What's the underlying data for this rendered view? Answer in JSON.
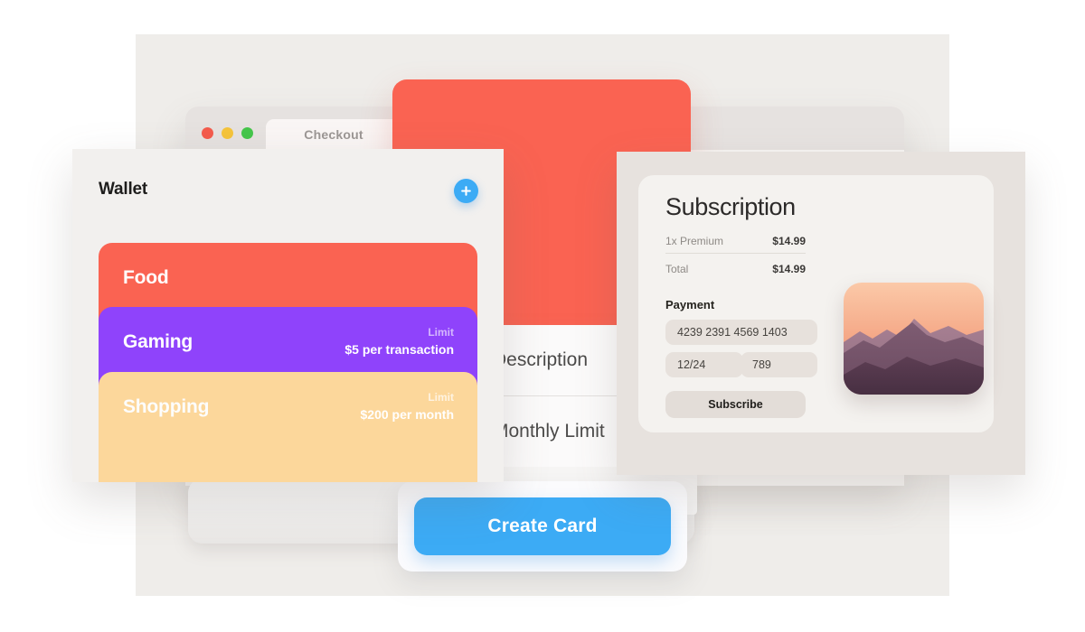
{
  "browser": {
    "tabs": [
      {
        "label": "Checkout"
      },
      {
        "label": ""
      }
    ],
    "window_controls": [
      "close",
      "minimize",
      "maximize"
    ]
  },
  "video_card": {
    "icon": "play-icon"
  },
  "wallet": {
    "title": "Wallet",
    "add_button_icon": "plus-icon",
    "accent": "#3CABF5",
    "cards": [
      {
        "name": "Food",
        "color": "#FA6352",
        "limit_label": "",
        "limit_value": ""
      },
      {
        "name": "Gaming",
        "color": "#8F43FB",
        "limit_label": "Limit",
        "limit_value": "$5 per transaction"
      },
      {
        "name": "Shopping",
        "color": "#FCD79B",
        "limit_label": "Limit",
        "limit_value": "$200 per month"
      }
    ]
  },
  "card_form": {
    "rows": [
      {
        "label": "Description"
      },
      {
        "label": "Monthly Limit"
      }
    ],
    "submit_label": "Create Card",
    "submit_color": "#3CABF5"
  },
  "subscription": {
    "title": "Subscription",
    "lines": [
      {
        "label": "1x Premium",
        "amount": "$14.99"
      },
      {
        "label": "Total",
        "amount": "$14.99"
      }
    ],
    "payment_heading": "Payment",
    "fields": {
      "card_number": "4239 2391 4569 1403",
      "expiry": "12/24",
      "cvc": "789"
    },
    "subscribe_label": "Subscribe",
    "photo_alt": "sunset-mountain-photo"
  }
}
